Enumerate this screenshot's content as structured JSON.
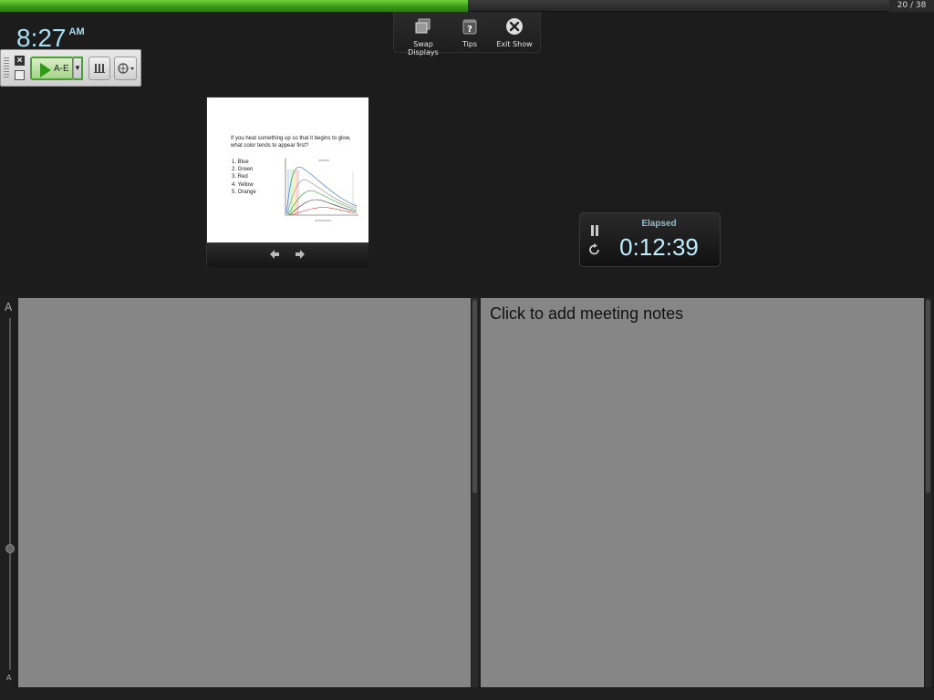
{
  "progress": {
    "fraction": 0.526
  },
  "slide_counter": "20 / 38",
  "clock": {
    "time": "8:27",
    "ampm": "AM"
  },
  "toolbar": {
    "swap_displays": "Swap Displays",
    "tips": "Tips",
    "exit_show": "Exit Show"
  },
  "palette": {
    "play_label": "A-E",
    "play_icon": "play-icon",
    "dropdown_icon": "chevron-down-icon",
    "bars_icon": "bar-chart-icon",
    "globe_icon": "globe-icon"
  },
  "slide": {
    "question": "If you heat something up so that it begins to glow, what color tends to appear first?",
    "options": [
      "1.  Blue",
      "2.  Green",
      "3.  Red",
      "4.  Yellow",
      "5.  Orange"
    ]
  },
  "timer": {
    "label": "Elapsed",
    "value": "0:12:39"
  },
  "font_size": {
    "large": "A",
    "small": "A"
  },
  "notes": {
    "placeholder": "Click to add meeting notes"
  },
  "colors": {
    "accent_green": "#4aa032",
    "clock_blue": "#a9dff3",
    "pane_gray": "#868686"
  }
}
